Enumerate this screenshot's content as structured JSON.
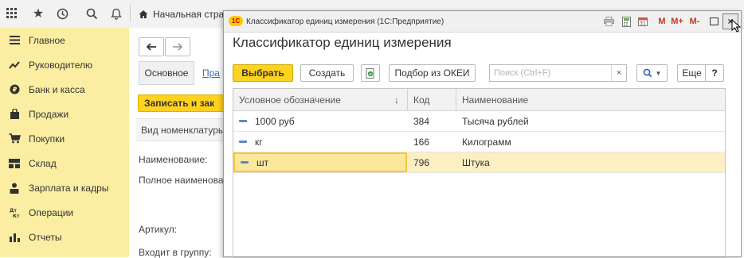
{
  "topbar": {
    "icons": [
      "apps-grid-icon",
      "star-icon",
      "history-icon",
      "search-icon",
      "bell-icon"
    ],
    "home_tab_label": "Начальная стра"
  },
  "sidebar": {
    "items": [
      {
        "label": "Главное",
        "icon": "menu-lines-icon"
      },
      {
        "label": "Руководителю",
        "icon": "trend-icon"
      },
      {
        "label": "Банк и касса",
        "icon": "coin-icon"
      },
      {
        "label": "Продажи",
        "icon": "bag-icon"
      },
      {
        "label": "Покупки",
        "icon": "cart-icon"
      },
      {
        "label": "Склад",
        "icon": "warehouse-icon"
      },
      {
        "label": "Зарплата и кадры",
        "icon": "person-icon"
      },
      {
        "label": "Операции",
        "icon": "dt-kt-icon"
      },
      {
        "label": "Отчеты",
        "icon": "bar-chart-icon"
      }
    ]
  },
  "background_form": {
    "tab_main": "Основное",
    "tab_link": "Пра",
    "save_button": "Записать и зак",
    "vid_label": "Вид номенклатуры",
    "labels": {
      "name": "Наименование:",
      "full_name": "Полное наименова",
      "article": "Артикул:",
      "group": "Входит в группу:"
    }
  },
  "modal": {
    "window_title": "Классификатор единиц измерения  (1С:Предприятие)",
    "logo_text": "1С",
    "window_buttons": [
      "M",
      "M+",
      "M-"
    ],
    "heading": "Классификатор единиц измерения",
    "toolbar": {
      "select": "Выбрать",
      "create": "Создать",
      "okei": "Подбор из ОКЕИ",
      "search_placeholder": "Поиск (Ctrl+F)",
      "clear": "×",
      "more": "Еще",
      "help": "?"
    },
    "table": {
      "columns": [
        "Условное обозначение",
        "Код",
        "Наименование"
      ],
      "sort_indicator": "↓",
      "rows": [
        {
          "symbol": "1000 руб",
          "code": "384",
          "name": "Тысяча рублей",
          "selected": false
        },
        {
          "symbol": "кг",
          "code": "166",
          "name": "Килограмм",
          "selected": false
        },
        {
          "symbol": "шт",
          "code": "796",
          "name": "Штука",
          "selected": true
        }
      ]
    }
  },
  "colors": {
    "sidebar_bg": "#fbeea2",
    "accent_yellow": "#ffd21f",
    "selected_row": "#fbefc3",
    "row_icon": "#5b87c5"
  }
}
